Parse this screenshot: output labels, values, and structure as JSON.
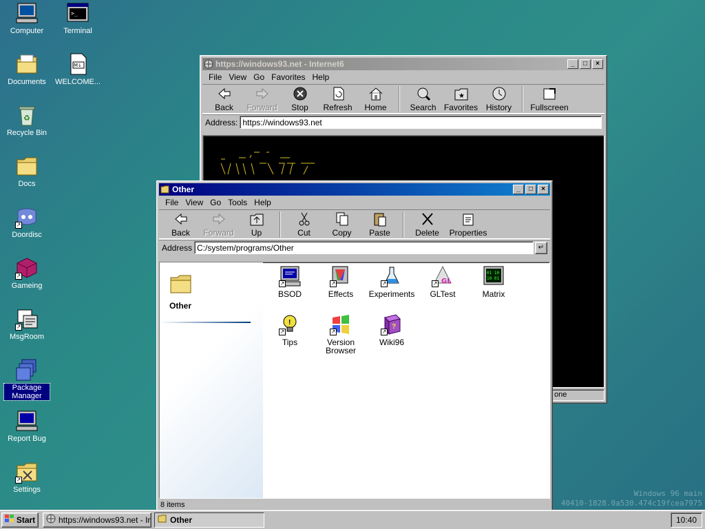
{
  "desktop": {
    "icons": [
      {
        "label": "Computer"
      },
      {
        "label": "Terminal"
      },
      {
        "label": "Documents"
      },
      {
        "label": "WELCOME..."
      },
      {
        "label": "Recycle Bin"
      },
      {
        "label": "Docs"
      },
      {
        "label": "Doordisc"
      },
      {
        "label": "Gameing"
      },
      {
        "label": "MsgRoom"
      },
      {
        "label": "Package Manager"
      },
      {
        "label": "Report Bug"
      },
      {
        "label": "Settings"
      }
    ],
    "watermark_line1": "Windows 96 main",
    "watermark_line2": "40410-1828.0a530.474c19fcea7975"
  },
  "browser": {
    "title": "https://windows93.net - Internet6",
    "menu": [
      "File",
      "View",
      "Go",
      "Favorites",
      "Help"
    ],
    "tools": [
      "Back",
      "Forward",
      "Stop",
      "Refresh",
      "Home",
      "Search",
      "Favorites",
      "History",
      "Fullscreen"
    ],
    "address_label": "Address:",
    "address_value": "https://windows93.net",
    "status": "one"
  },
  "explorer": {
    "title": "Other",
    "menu": [
      "File",
      "View",
      "Go",
      "Tools",
      "Help"
    ],
    "tools": [
      "Back",
      "Forward",
      "Up",
      "Cut",
      "Copy",
      "Paste",
      "Delete",
      "Properties"
    ],
    "address_label": "Address",
    "address_value": "C:/system/programs/Other",
    "sidebar_title": "Other",
    "files": [
      {
        "label": "BSOD"
      },
      {
        "label": "Effects"
      },
      {
        "label": "Experiments"
      },
      {
        "label": "GLTest"
      },
      {
        "label": "Matrix"
      },
      {
        "label": "Tips"
      },
      {
        "label": "Version Browser"
      },
      {
        "label": "Wiki96"
      }
    ],
    "status": "8 items"
  },
  "taskbar": {
    "start_label": "Start",
    "tasks": [
      "https://windows93.net - Int...",
      "Other"
    ],
    "clock": "10:40"
  },
  "colors": {
    "title_active": "#000080",
    "title_gradient_end": "#1084d0",
    "desktop": "#2a8a86"
  }
}
